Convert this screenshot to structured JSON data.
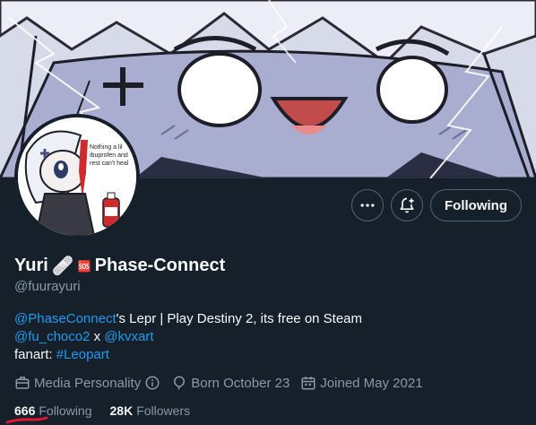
{
  "profile": {
    "display_name": "Yuri",
    "display_name_suffix": "Phase-Connect",
    "emoji_bandage": "🩹",
    "emoji_box": "🆘",
    "handle": "@fuurayuri"
  },
  "avatar_caption": {
    "line1": "Nothing a lil",
    "line2": "ibuprofen and",
    "line3": "rest can't heal"
  },
  "actions": {
    "more_icon": "more-horizontal-icon",
    "notify_icon": "bell-plus-icon",
    "follow_label": "Following"
  },
  "bio": {
    "mention1": "@PhaseConnect",
    "line1_rest": "'s Lepr | Play Destiny 2, its free on Steam",
    "mention2": "@fu_choco2",
    "connector": " x ",
    "mention3": "@kvxart",
    "fanart_label": "fanart: ",
    "hashtag": "#Leopart"
  },
  "meta": {
    "category": "Media Personality",
    "born": "Born October 23",
    "joined": "Joined May 2021"
  },
  "stats": {
    "following_count": "666",
    "following_label": "Following",
    "followers_count": "28K",
    "followers_label": "Followers"
  },
  "colors": {
    "background": "#15202b",
    "text_primary": "#f7f9f9",
    "text_secondary": "#8b98a5",
    "link": "#1d9bf0",
    "border": "#536471",
    "annotation_red": "#e0182d"
  }
}
